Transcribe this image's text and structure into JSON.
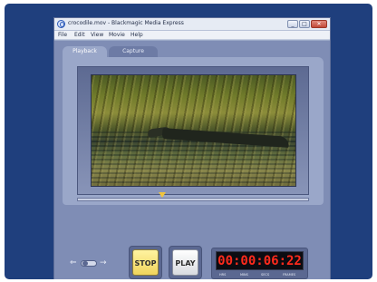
{
  "window": {
    "title": "crocodile.mov - Blackmagic Media Express",
    "controls": {
      "minimize": "_",
      "maximize": "□",
      "close": "✕"
    }
  },
  "menu": {
    "items": [
      {
        "label": "File"
      },
      {
        "label": "Edit"
      },
      {
        "label": "View"
      },
      {
        "label": "Movie"
      },
      {
        "label": "Help"
      }
    ]
  },
  "tabs": [
    {
      "label": "Playback",
      "selected": true
    },
    {
      "label": "Capture",
      "selected": false
    }
  ],
  "transport": {
    "stop_label": "STOP",
    "play_label": "PLAY",
    "toggle_left_icon": "left-arrow-icon",
    "toggle_right_icon": "right-arrow-icon"
  },
  "timecode": {
    "value": "00:00:06:22",
    "labels": [
      "HRS",
      "MINS",
      "SECS",
      "FRAMES"
    ]
  },
  "colors": {
    "background": "#1f3f7d",
    "stop_button": "#f0d45c",
    "timecode": "#ff2a1c",
    "scrub_marker": "#f1c43c"
  }
}
